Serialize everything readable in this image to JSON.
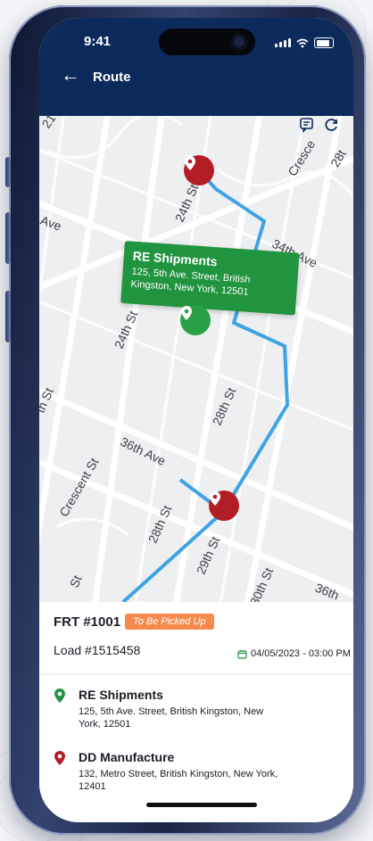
{
  "status_bar": {
    "time": "9:41"
  },
  "header": {
    "title": "Route"
  },
  "map": {
    "street_labels": [
      "24th St",
      "24th St",
      "34th Ave",
      "Ave",
      "Cresce",
      "28t",
      "28th St",
      "th St",
      "36th Ave",
      "Crescent St",
      "28th St",
      "29th St",
      "30th St",
      "36th",
      "St",
      "21"
    ],
    "callout": {
      "name": "RE Shipments",
      "address": "125, 5th Ave. Street, British Kingston, New York, 12501"
    }
  },
  "shipment": {
    "frt_number": "FRT #1001",
    "status": "To Be Picked Up",
    "load_number": "Load #1515458",
    "datetime": "04/05/2023 - 03:00 PM"
  },
  "stops": [
    {
      "name": "RE Shipments",
      "address": "125, 5th Ave. Street, British Kingston, New York, 12501"
    },
    {
      "name": "DD Manufacture",
      "address": "132, Metro Street, British Kingston, New York, 12401"
    }
  ],
  "colors": {
    "header": "#0d2a5c",
    "route_line": "#3fa3e4",
    "pickup_green": "#21943f",
    "drop_red": "#b31e26",
    "status_badge": "#f58a4c"
  }
}
